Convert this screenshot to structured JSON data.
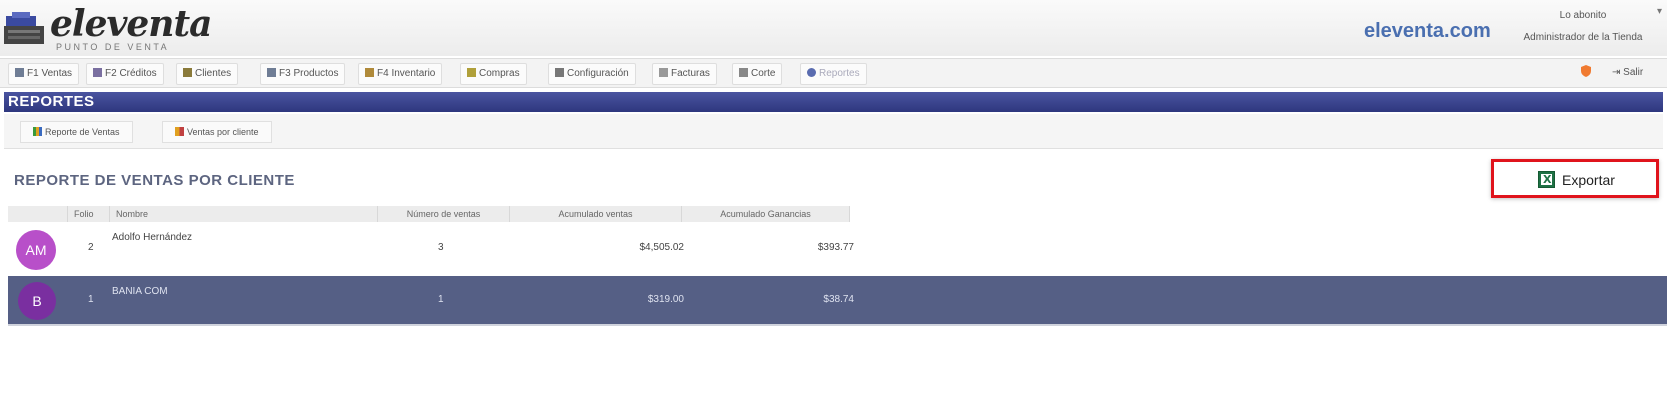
{
  "header": {
    "logo_text": "eleventa",
    "logo_subtitle": "PUNTO DE VENTA",
    "site_link": "eleventa.com",
    "user_name": "Lo abonito",
    "user_role": "Administrador de la Tienda",
    "user_caret": "▾"
  },
  "nav": {
    "items": [
      {
        "label": "F1 Ventas",
        "icon": "register-icon",
        "color": "#6f7d95"
      },
      {
        "label": "F2 Créditos",
        "icon": "credit-icon",
        "color": "#7a6fa0"
      },
      {
        "label": "Clientes",
        "icon": "clients-icon",
        "color": "#8a7a3a"
      },
      {
        "label": "F3 Productos",
        "icon": "products-icon",
        "color": "#6f7d95"
      },
      {
        "label": "F4 Inventario",
        "icon": "inventory-icon",
        "color": "#b08a3a"
      },
      {
        "label": "Compras",
        "icon": "purchases-icon",
        "color": "#b0a03a"
      },
      {
        "label": "Configuración",
        "icon": "settings-icon",
        "color": "#777"
      },
      {
        "label": "Facturas",
        "icon": "invoice-icon",
        "color": "#999"
      },
      {
        "label": "Corte",
        "icon": "cut-icon",
        "color": "#888"
      },
      {
        "label": "Reportes",
        "icon": "reports-icon",
        "color": "#5a6cb0"
      }
    ],
    "exit_label": "Salir",
    "exit_icon": "exit-icon",
    "alert_icon": "shield-icon"
  },
  "section": {
    "title": "REPORTES",
    "tabs": [
      {
        "label": "Reporte de Ventas",
        "icon": "chart-icon"
      },
      {
        "label": "Ventas por cliente",
        "icon": "clients-chart-icon"
      }
    ]
  },
  "report": {
    "title": "REPORTE DE VENTAS POR CLIENTE",
    "export_label": "Exportar",
    "export_border_color": "#e0141c",
    "columns": [
      "Folio",
      "Nombre",
      "Número de ventas",
      "Acumulado ventas",
      "Acumulado Ganancias"
    ],
    "rows": [
      {
        "initials": "AM",
        "avatar_color": "#b84fc9",
        "folio": "2",
        "name": "Adolfo Hernández",
        "sales_count": "3",
        "sales_total": "$4,505.02",
        "profit_total": "$393.77",
        "selected": false
      },
      {
        "initials": "B",
        "avatar_color": "#7a2fa0",
        "folio": "1",
        "name": "BANIA COM",
        "sales_count": "1",
        "sales_total": "$319.00",
        "profit_total": "$38.74",
        "selected": true
      }
    ]
  },
  "colors": {
    "section_bar": "#2e377e",
    "selected_row": "#555f85"
  }
}
